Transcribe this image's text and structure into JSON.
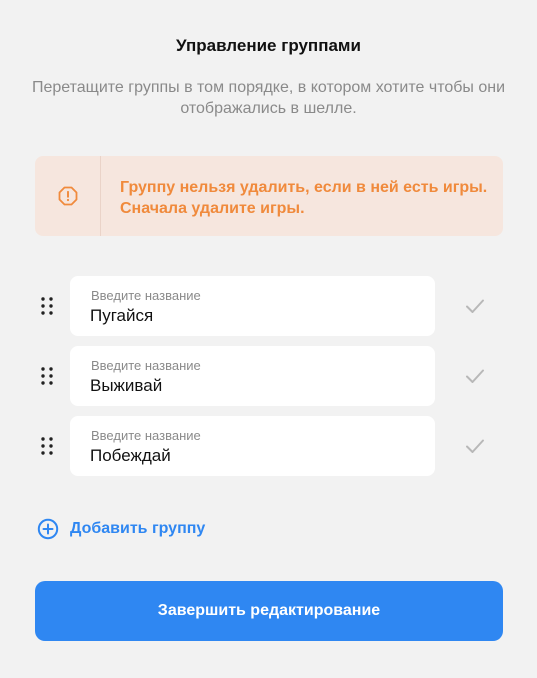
{
  "dialog": {
    "title": "Управление группами",
    "subtitle": "Перетащите группы в том порядке, в котором хотите чтобы они отображались в шелле."
  },
  "warning": {
    "icon": "alert-octagon-icon",
    "text": "Группу нельзя удалить, если в ней есть игры. Сначала удалите игры."
  },
  "groups": [
    {
      "label": "Введите название",
      "value": "Пугайся"
    },
    {
      "label": "Введите название",
      "value": "Выживай"
    },
    {
      "label": "Введите название",
      "value": "Побеждай"
    }
  ],
  "add_group": {
    "label": "Добавить группу",
    "icon": "plus-circle-icon"
  },
  "finish_button": {
    "label": "Завершить редактирование"
  },
  "colors": {
    "accent": "#2f87f2",
    "warning_text": "#f08a3c",
    "warning_bg": "#f6e6de",
    "background": "#f2f2f2"
  }
}
